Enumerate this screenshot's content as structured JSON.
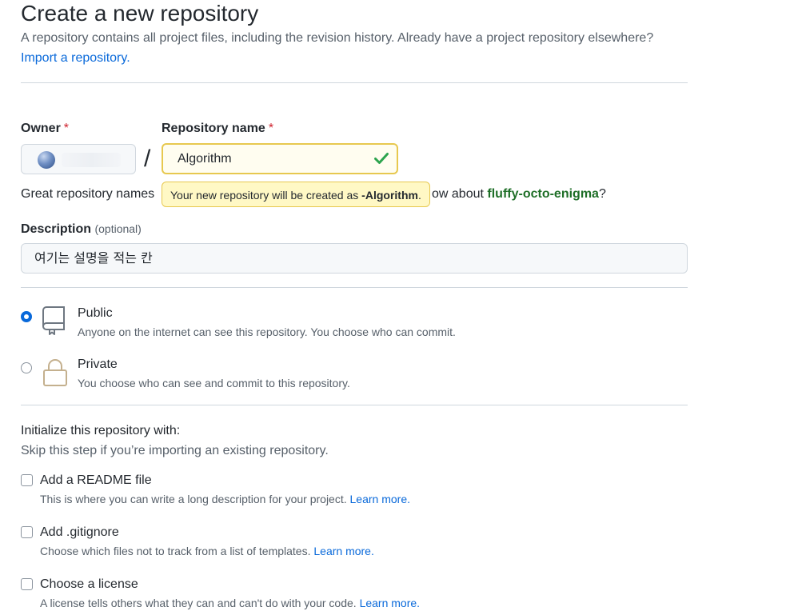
{
  "header": {
    "title": "Create a new repository",
    "subtitle": "A repository contains all project files, including the revision history. Already have a project repository elsewhere?",
    "import_link": "Import a repository."
  },
  "owner": {
    "label": "Owner",
    "required_mark": "*"
  },
  "separator": "/",
  "repo_name": {
    "label": "Repository name",
    "required_mark": "*",
    "value": "Algorithm",
    "valid_icon": "check-icon"
  },
  "hint": {
    "prefix": "Great repository names",
    "suffix": "ow about",
    "suggestion": "fluffy-octo-enigma",
    "end": "?"
  },
  "tooltip": {
    "text": "Your new repository will be created as",
    "name": "-Algorithm",
    "end": "."
  },
  "description": {
    "label": "Description",
    "optional": "(optional)",
    "value": "여기는 설명을 적는 칸"
  },
  "visibility": {
    "public": {
      "title": "Public",
      "desc": "Anyone on the internet can see this repository. You choose who can commit.",
      "icon": "repo-icon",
      "selected": true
    },
    "private": {
      "title": "Private",
      "desc": "You choose who can see and commit to this repository.",
      "icon": "lock-icon",
      "selected": false
    }
  },
  "init": {
    "title": "Initialize this repository with:",
    "subtitle": "Skip this step if you’re importing an existing repository.",
    "options": [
      {
        "title": "Add a README file",
        "desc": "This is where you can write a long description for your project.",
        "link": "Learn more."
      },
      {
        "title": "Add .gitignore",
        "desc": "Choose which files not to track from a list of templates.",
        "link": "Learn more."
      },
      {
        "title": "Choose a license",
        "desc": "A license tells others what they can and can't do with your code.",
        "link": "Learn more."
      }
    ]
  },
  "colors": {
    "accent": "#0969da",
    "success": "#2da44e",
    "warning_border": "#e7c84f",
    "tooltip_bg": "#fff8c5",
    "suggestion": "#1f6f28"
  }
}
